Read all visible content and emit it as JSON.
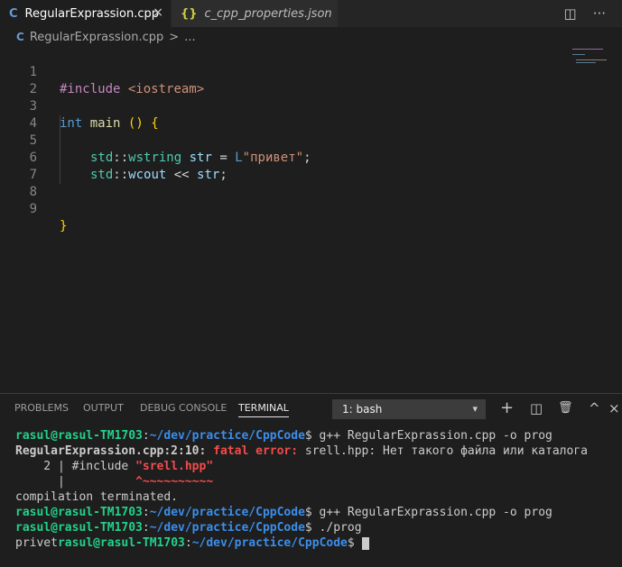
{
  "tabs": [
    {
      "icon": "C",
      "label": "RegularExprassion.cpp",
      "close": "×",
      "active": true
    },
    {
      "icon": "{}",
      "label": "c_cpp_properties.json",
      "active": false
    }
  ],
  "topbar": {
    "split_icon": "◫",
    "more_icon": "···"
  },
  "breadcrumb": {
    "icon": "C",
    "file": "RegularExprassion.cpp",
    "sep": ">",
    "rest": "..."
  },
  "editor": {
    "line_numbers": [
      "1",
      "2",
      "3",
      "4",
      "5",
      "6",
      "7",
      "8",
      "9"
    ],
    "lines": {
      "l1_directive": "#include",
      "l1_header": "<iostream>",
      "l3_type": "int",
      "l3_name": "main",
      "l3_parens": "()",
      "l3_brace": "{",
      "l5_ns": "std",
      "l5_sep": "::",
      "l5_type": "wstring",
      "l5_var": "str",
      "l5_eq": "=",
      "l5_prefix": "L",
      "l5_string": "\"привет\"",
      "l5_semi": ";",
      "l6_ns": "std",
      "l6_sep": "::",
      "l6_obj": "wcout",
      "l6_op": "<<",
      "l6_var": "str",
      "l6_semi": ";",
      "l9_brace": "}"
    }
  },
  "panel": {
    "tabs": [
      "PROBLEMS",
      "OUTPUT",
      "DEBUG CONSOLE",
      "TERMINAL"
    ],
    "active_tab": "TERMINAL",
    "terminal_select": "1: bash",
    "icons": {
      "add": "+",
      "split": "◫",
      "trash": "🗑",
      "up": "^",
      "close": "×"
    }
  },
  "terminal": {
    "user": "rasul@rasul-TM1703",
    "colon": ":",
    "path": "~/dev/practice/CppCode",
    "prompt_char": "$",
    "cmd1": " g++ RegularExprassion.cpp -o prog",
    "err_loc": "RegularExprassion.cpp:2:10:",
    "err_label": "fatal error:",
    "err_msg": " srell.hpp: Нет такого файла или каталога",
    "src_prefix": "    2 | #include ",
    "src_include": "\"srell.hpp\"",
    "caret_prefix": "      |          ",
    "caret": "^~~~~~~~~~~",
    "terminated": "compilation terminated.",
    "cmd2": " g++ RegularExprassion.cpp -o prog",
    "cmd3": " ./prog",
    "output": "privet"
  }
}
